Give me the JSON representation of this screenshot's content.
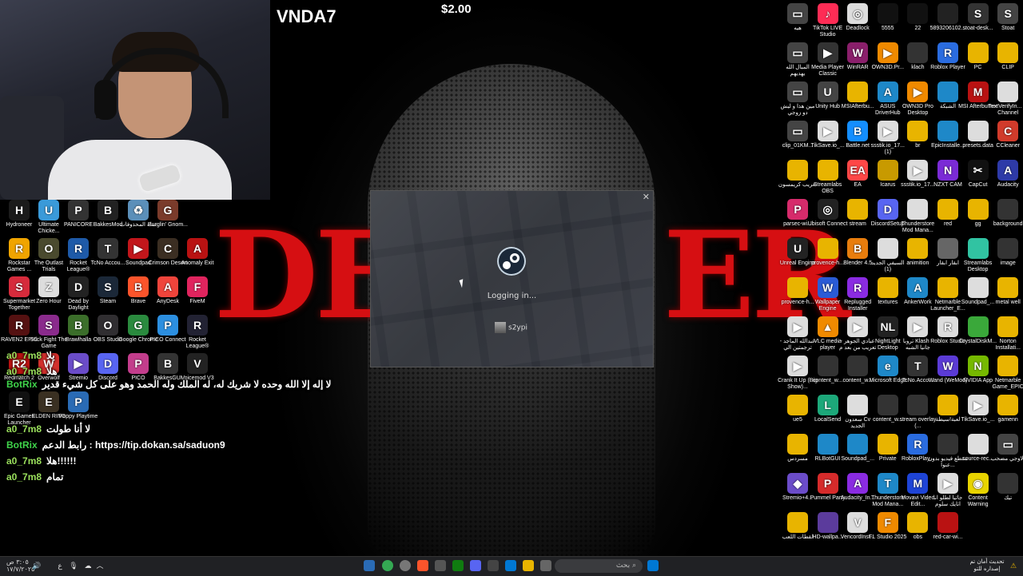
{
  "stream": {
    "streamer_name": "VNDA7",
    "donation": "$2.00"
  },
  "backdrop": {
    "title_left": "DE",
    "title_right": "ER"
  },
  "chat": [
    {
      "user": "a0_7m8",
      "text": "يلا"
    },
    {
      "user": "a0_7m8",
      "text": "هلا"
    },
    {
      "user": "BotRix",
      "text": "لا إله إلا الله وحده لا شريك له، له الملك وله الحمد وهو على كل شيء قدير",
      "bot": true
    },
    {
      "user": "a0_7m8",
      "text": "لا أنا طولت"
    },
    {
      "user": "BotRix",
      "text": "رابط الدعم : https://tip.dokan.sa/saduon9",
      "bot": true
    },
    {
      "user": "a0_7m8",
      "text": "هلا!!!!!!"
    },
    {
      "user": "a0_7m8",
      "text": "تمام"
    }
  ],
  "steam_dialog": {
    "status": "Logging in...",
    "account": "s2ypi",
    "close_label": "✕"
  },
  "left_icons": [
    {
      "label": "Hydroneer",
      "glyph": "H",
      "color": "#1b1b1b"
    },
    {
      "label": "Ultimate Chicke...",
      "glyph": "U",
      "color": "#3a9ad9"
    },
    {
      "label": "PANICORE",
      "glyph": "P",
      "color": "#333"
    },
    {
      "label": "BakkesMod",
      "glyph": "B",
      "color": "#222"
    },
    {
      "label": "سلة المحذوفات",
      "glyph": "♻",
      "color": "#5b8fb9"
    },
    {
      "label": "Burglin' Gnom...",
      "glyph": "G",
      "color": "#7a3b2b"
    },
    {
      "label": "Rockstar Games ...",
      "glyph": "R",
      "color": "#f0a400"
    },
    {
      "label": "The Outlast Trials",
      "glyph": "O",
      "color": "#4a4a2e"
    },
    {
      "label": "Rocket League®",
      "glyph": "R",
      "color": "#1e5aa8"
    },
    {
      "label": "TcNo Accou...",
      "glyph": "T",
      "color": "#333"
    },
    {
      "label": "Soundpad",
      "glyph": "▶",
      "color": "#c2161b"
    },
    {
      "label": "Crimson Desert",
      "glyph": "C",
      "color": "#3b2e22"
    },
    {
      "label": "Anomaly Exit",
      "glyph": "A",
      "color": "#b91212"
    },
    {
      "label": "Supermarket Together",
      "glyph": "S",
      "color": "#d62b3c"
    },
    {
      "label": "Zero Hour",
      "glyph": "Z",
      "color": "#ddd"
    },
    {
      "label": "Dead by Daylight",
      "glyph": "D",
      "color": "#222"
    },
    {
      "label": "Steam",
      "glyph": "S",
      "color": "#1b2838"
    },
    {
      "label": "Brave",
      "glyph": "B",
      "color": "#fb542b"
    },
    {
      "label": "AnyDesk",
      "glyph": "A",
      "color": "#ef443b"
    },
    {
      "label": "FiveM",
      "glyph": "F",
      "color": "#e0245e"
    },
    {
      "label": "RAVEN2 EPIC",
      "glyph": "R",
      "color": "#551111"
    },
    {
      "label": "Stick Fight The Game",
      "glyph": "S",
      "color": "#8a2b8c"
    },
    {
      "label": "Brawlhalla",
      "glyph": "B",
      "color": "#3b6e2a"
    },
    {
      "label": "OBS Studio",
      "glyph": "O",
      "color": "#302e31"
    },
    {
      "label": "Google Chrome",
      "glyph": "G",
      "color": "#2a8a3e"
    },
    {
      "label": "PICO Connect",
      "glyph": "P",
      "color": "#2c8fe0"
    },
    {
      "label": "Rocket League®",
      "glyph": "R",
      "color": "#223"
    },
    {
      "label": "Redmatch 2",
      "glyph": "R2",
      "color": "#b91212"
    },
    {
      "label": "Overwolf",
      "glyph": "W",
      "color": "#d3302d"
    },
    {
      "label": "Stremio",
      "glyph": "▶",
      "color": "#6b4cc9"
    },
    {
      "label": "Discord",
      "glyph": "D",
      "color": "#5865f2"
    },
    {
      "label": "PICO",
      "glyph": "P",
      "color": "#c33d8c"
    },
    {
      "label": "BakkesGUI",
      "glyph": "B",
      "color": "#333"
    },
    {
      "label": "Voicemod V3",
      "glyph": "V",
      "color": "#222"
    },
    {
      "label": "Epic Games Launcher",
      "glyph": "E",
      "color": "#111"
    },
    {
      "label": "ELDEN RING",
      "glyph": "E",
      "color": "#3a3022"
    },
    {
      "label": "Poppy Playtime",
      "glyph": "P",
      "color": "#2a6bb5"
    }
  ],
  "right_icons": [
    {
      "label": "هيه",
      "glyph": "▭",
      "color": "#444"
    },
    {
      "label": "TikTok LIVE Studio",
      "glyph": "♪",
      "color": "#fe2c55"
    },
    {
      "label": "Deadlock",
      "glyph": "◎",
      "color": "#ddd"
    },
    {
      "label": "5555",
      "glyph": "",
      "color": "#111"
    },
    {
      "label": "22",
      "glyph": "",
      "color": "#111"
    },
    {
      "label": "5893206102...",
      "glyph": "",
      "color": "#222"
    },
    {
      "label": "stoat-desk...",
      "glyph": "S",
      "color": "#333"
    },
    {
      "label": "Stoat",
      "glyph": "S",
      "color": "#444"
    },
    {
      "label": "المبال الله يهديهم",
      "glyph": "▭",
      "color": "#444"
    },
    {
      "label": "Media Player Classic",
      "glyph": "▶",
      "color": "#333"
    },
    {
      "label": "WinRAR",
      "glyph": "W",
      "color": "#8a1f6b"
    },
    {
      "label": "OWN3D.Pr...",
      "glyph": "▶",
      "color": "#f08a00"
    },
    {
      "label": "klach",
      "glyph": "",
      "color": "#333"
    },
    {
      "label": "Roblox Player",
      "glyph": "R",
      "color": "#2a6ce0"
    },
    {
      "label": "PC",
      "glyph": "",
      "color": "#e8b400"
    },
    {
      "label": "CLIP",
      "glyph": "",
      "color": "#e8b400"
    },
    {
      "label": "مين هذا و ليش دو زوجي",
      "glyph": "▭",
      "color": "#444"
    },
    {
      "label": "Unity Hub",
      "glyph": "U",
      "color": "#444"
    },
    {
      "label": "MSIAfterbu...",
      "glyph": "",
      "color": "#e8b400"
    },
    {
      "label": "ASUS DriverHub",
      "glyph": "A",
      "color": "#1e88c8"
    },
    {
      "label": "OWN3D Pro Desktop",
      "glyph": "▶",
      "color": "#f08a00"
    },
    {
      "label": "الشبكة",
      "glyph": "",
      "color": "#1e88c8"
    },
    {
      "label": "MSI Afterburner",
      "glyph": "M",
      "color": "#b91212"
    },
    {
      "label": "TextVerifyIn... to Channel",
      "glyph": "",
      "color": "#ddd"
    },
    {
      "label": "clip_01KM...",
      "glyph": "▭",
      "color": "#444"
    },
    {
      "label": "TikSave.io_...",
      "glyph": "▶",
      "color": "#ddd"
    },
    {
      "label": "Battle.net",
      "glyph": "B",
      "color": "#148eff"
    },
    {
      "label": "ssstik.io_17... (1)",
      "glyph": "▶",
      "color": "#ddd"
    },
    {
      "label": "br",
      "glyph": "",
      "color": "#e8b400"
    },
    {
      "label": "EpicInstalle...",
      "glyph": "",
      "color": "#1e88c8"
    },
    {
      "label": "presets.data",
      "glyph": "",
      "color": "#ddd"
    },
    {
      "label": "CCleaner",
      "glyph": "C",
      "color": "#d13b2b"
    },
    {
      "label": "تعريب كريمسون",
      "glyph": "",
      "color": "#e8b400"
    },
    {
      "label": "Streamlabs OBS",
      "glyph": "",
      "color": "#e8b400"
    },
    {
      "label": "EA",
      "glyph": "EA",
      "color": "#ff4747"
    },
    {
      "label": "Icarus",
      "glyph": "",
      "color": "#c89a00"
    },
    {
      "label": "ssstik.io_17...",
      "glyph": "▶",
      "color": "#ddd"
    },
    {
      "label": "NZXT CAM",
      "glyph": "N",
      "color": "#7b2bd6"
    },
    {
      "label": "CapCut",
      "glyph": "✂",
      "color": "#111"
    },
    {
      "label": "Audacity",
      "glyph": "A",
      "color": "#2e3aa8"
    },
    {
      "label": "parsec-wi...",
      "glyph": "P",
      "color": "#d62b6b"
    },
    {
      "label": "Ubisoft Connect",
      "glyph": "◎",
      "color": "#222"
    },
    {
      "label": "stream",
      "glyph": "",
      "color": "#e8b400"
    },
    {
      "label": "DiscordSetup",
      "glyph": "D",
      "color": "#5865f2"
    },
    {
      "label": "Thunderstore Mod Mana...",
      "glyph": "",
      "color": "#ddd"
    },
    {
      "label": "red",
      "glyph": "",
      "color": "#e8b400"
    },
    {
      "label": "gg",
      "glyph": "",
      "color": "#e8b400"
    },
    {
      "label": "background",
      "glyph": "",
      "color": "#333"
    },
    {
      "label": "Unreal Engine",
      "glyph": "U",
      "color": "#222"
    },
    {
      "label": "provence-h...",
      "glyph": "",
      "color": "#e8b400"
    },
    {
      "label": "Blender 4.5",
      "glyph": "B",
      "color": "#e87d0d"
    },
    {
      "label": "السيفي الجديد (1)",
      "glyph": "",
      "color": "#ddd"
    },
    {
      "label": "animition",
      "glyph": "",
      "color": "#e8b400"
    },
    {
      "label": "ابقار ابقار",
      "glyph": "",
      "color": "#666"
    },
    {
      "label": "Streamlabs Desktop",
      "glyph": "",
      "color": "#31c3a2"
    },
    {
      "label": "image",
      "glyph": "",
      "color": "#333"
    },
    {
      "label": "provence-h...",
      "glyph": "",
      "color": "#e8b400"
    },
    {
      "label": "Wallpaper Engine",
      "glyph": "W",
      "color": "#2a5bd6"
    },
    {
      "label": "Replugged Installer",
      "glyph": "R",
      "color": "#8a2be2"
    },
    {
      "label": "textures",
      "glyph": "",
      "color": "#e8b400"
    },
    {
      "label": "AnkerWork",
      "glyph": "A",
      "color": "#1e88c8"
    },
    {
      "label": "Netmarble Launcher_E...",
      "glyph": "",
      "color": "#e8b400"
    },
    {
      "label": "Soundpad_...",
      "glyph": "",
      "color": "#ddd"
    },
    {
      "label": "metal well",
      "glyph": "",
      "color": "#e8b400"
    },
    {
      "label": "عبدالله الماجد - ترجمتين الي",
      "glyph": "▶",
      "color": "#ddd"
    },
    {
      "label": "VLC media player",
      "glyph": "▲",
      "color": "#f08a00"
    },
    {
      "label": "عبادي الجوهر - تعريب من بعد م",
      "glyph": "▶",
      "color": "#ddd"
    },
    {
      "label": "NightLight Desktop",
      "glyph": "NL",
      "color": "#222"
    },
    {
      "label": "تروبا Klash - جانيا الشبه",
      "glyph": "▶",
      "color": "#ddd"
    },
    {
      "label": "Roblox Studio",
      "glyph": "R",
      "color": "#ddd"
    },
    {
      "label": "CrystalDiskM...",
      "glyph": "",
      "color": "#3aa83a"
    },
    {
      "label": "Norton Installati...",
      "glyph": "",
      "color": "#e8b400"
    },
    {
      "label": "Crank It Up (Big Show)...",
      "glyph": "▶",
      "color": "#ddd"
    },
    {
      "label": "content_w...",
      "glyph": "",
      "color": "#333"
    },
    {
      "label": "content_w...",
      "glyph": "",
      "color": "#333"
    },
    {
      "label": "Microsoft Edge",
      "glyph": "e",
      "color": "#1e88c8"
    },
    {
      "label": "TcNo.Acco...",
      "glyph": "T",
      "color": "#333"
    },
    {
      "label": "Wand (WeMod)",
      "glyph": "W",
      "color": "#5b3bd6"
    },
    {
      "label": "NVIDIA App",
      "glyph": "N",
      "color": "#76b900"
    },
    {
      "label": "Netmarble Game_EPIC",
      "glyph": "",
      "color": "#e8b400"
    },
    {
      "label": "ue5",
      "glyph": "",
      "color": "#e8b400"
    },
    {
      "label": "LocalSend",
      "glyph": "L",
      "color": "#1da87a"
    },
    {
      "label": "سعدون Cv الجديد",
      "glyph": "",
      "color": "#ddd"
    },
    {
      "label": "content_w...",
      "glyph": "",
      "color": "#333"
    },
    {
      "label": "stream overlay (...",
      "glyph": "",
      "color": "#333"
    },
    {
      "label": "لعبة!سيطة",
      "glyph": "",
      "color": "#e8b400"
    },
    {
      "label": "TikSave.io_...",
      "glyph": "▶",
      "color": "#ddd"
    },
    {
      "label": "gamenn",
      "glyph": "",
      "color": "#e8b400"
    },
    {
      "label": "مسردس",
      "glyph": "",
      "color": "#e8b400"
    },
    {
      "label": "RLBotGUI",
      "glyph": "",
      "color": "#1e88c8"
    },
    {
      "label": "Soundpad_...",
      "glyph": "",
      "color": "#1e88c8"
    },
    {
      "label": "Private",
      "glyph": "",
      "color": "#e8b400"
    },
    {
      "label": "RobloxPlay...",
      "glyph": "R",
      "color": "#2a6ce0"
    },
    {
      "label": "مقطع فيديو بدون عنوا...",
      "glyph": "",
      "color": "#333"
    },
    {
      "label": "source-rec...",
      "glyph": "",
      "color": "#ddd"
    },
    {
      "label": "الاوجي مضحب",
      "glyph": "▭",
      "color": "#444"
    },
    {
      "label": "Stremio+4...",
      "glyph": "◆",
      "color": "#6b4cc9"
    },
    {
      "label": "Pummel Party",
      "glyph": "P",
      "color": "#d62b2b"
    },
    {
      "label": "Audacity_In...",
      "glyph": "A",
      "color": "#8a2be2"
    },
    {
      "label": "Thunderstore Mod Mana...",
      "glyph": "T",
      "color": "#1e88c8"
    },
    {
      "label": "Movavi Video Edit...",
      "glyph": "M",
      "color": "#1e44d6"
    },
    {
      "label": "جاتيا لطلو انا اتايك سلوم",
      "glyph": "▶",
      "color": "#ddd"
    },
    {
      "label": "Content Warning",
      "glyph": "◉",
      "color": "#e8d400"
    },
    {
      "label": "تيك",
      "glyph": "",
      "color": "#333"
    },
    {
      "label": "لقطات اللعب",
      "glyph": "",
      "color": "#e8b400"
    },
    {
      "label": "HD-wallpa...",
      "glyph": "",
      "color": "#5b3b9c"
    },
    {
      "label": "VencordInst...",
      "glyph": "V",
      "color": "#ddd"
    },
    {
      "label": "FL Studio 2025",
      "glyph": "F",
      "color": "#f08a00"
    },
    {
      "label": "obs",
      "glyph": "",
      "color": "#e8b400"
    },
    {
      "label": "red-car-wi...",
      "glyph": "",
      "color": "#b91212"
    }
  ],
  "taskbar": {
    "clock_time": "٣:٠٥ ص",
    "clock_date": "١٧/٧/٢٠٢٥",
    "search_placeholder": "بحث",
    "notification": "تحديث أمان تم إصداره للتو",
    "tray": "ع"
  }
}
